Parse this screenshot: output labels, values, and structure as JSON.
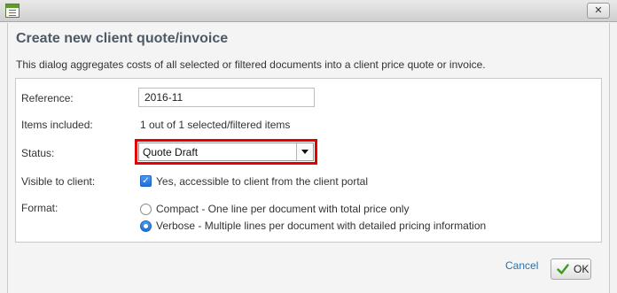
{
  "window": {
    "close_glyph": "✕"
  },
  "dialog": {
    "title": "Create new client quote/invoice",
    "description": "This dialog aggregates costs of all selected or filtered documents into a client price quote or invoice."
  },
  "form": {
    "reference": {
      "label": "Reference:",
      "value": "2016-11"
    },
    "items_included": {
      "label": "Items included:",
      "value": "1 out of 1 selected/filtered items"
    },
    "status": {
      "label": "Status:",
      "selected": "Quote Draft"
    },
    "visible_to_client": {
      "label": "Visible to client:",
      "checked": true,
      "option_label": "Yes, accessible to client from the client portal"
    },
    "format": {
      "label": "Format:",
      "options": [
        {
          "label": "Compact - One line per document with total price only",
          "selected": false
        },
        {
          "label": "Verbose - Multiple lines per document with detailed pricing information",
          "selected": true
        }
      ]
    }
  },
  "actions": {
    "cancel_label": "Cancel",
    "ok_label": "OK"
  },
  "colors": {
    "highlight": "#e60000",
    "accent_blue": "#1f6fd6",
    "link": "#2f6ea6"
  }
}
